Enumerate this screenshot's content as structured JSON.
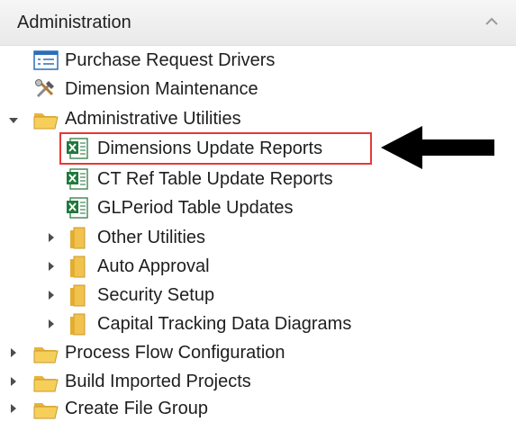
{
  "panel": {
    "title": "Administration",
    "collapse_icon": "chevron-up-icon"
  },
  "tree": {
    "purchase_request_drivers": "Purchase Request Drivers",
    "dimension_maintenance": "Dimension Maintenance",
    "administrative_utilities": "Administrative Utilities",
    "dimensions_update_reports": "Dimensions Update Reports",
    "ct_ref_table_update_reports": "CT Ref Table Update Reports",
    "glperiod_table_updates": "GLPeriod Table Updates",
    "other_utilities": "Other Utilities",
    "auto_approval": "Auto Approval",
    "security_setup": "Security Setup",
    "capital_tracking_data_diagrams": "Capital Tracking Data Diagrams",
    "process_flow_configuration": "Process Flow Configuration",
    "build_imported_projects": "Build Imported Projects",
    "create_file_group": "Create File Group"
  },
  "colors": {
    "highlight_border": "#e53935",
    "folder": "#f4c84a",
    "excel_green": "#1f7a3a"
  }
}
